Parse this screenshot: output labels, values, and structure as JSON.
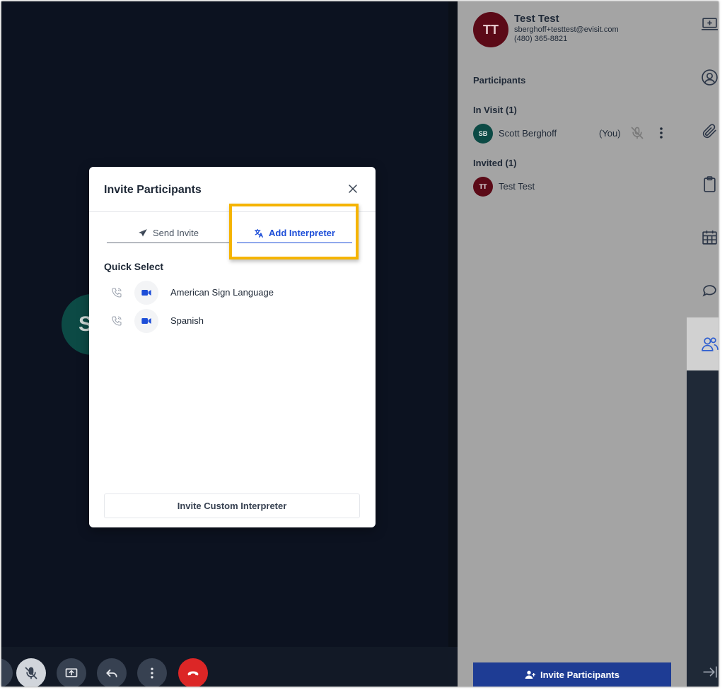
{
  "video": {
    "avatar_initials": "S"
  },
  "panel": {
    "header": {
      "initials": "TT",
      "name": "Test Test",
      "email": "sberghoff+testtest@evisit.com",
      "phone": "(480) 365-8821"
    },
    "participants_title": "Participants",
    "in_visit": {
      "label": "In Visit (1)",
      "items": [
        {
          "initials": "SB",
          "name": "Scott Berghoff",
          "tag": "(You)"
        }
      ]
    },
    "invited": {
      "label": "Invited (1)",
      "items": [
        {
          "initials": "TT",
          "name": "Test Test"
        }
      ]
    },
    "invite_button_label": "Invite Participants"
  },
  "modal": {
    "title": "Invite Participants",
    "tabs": [
      {
        "label": "Send Invite",
        "active": false
      },
      {
        "label": "Add Interpreter",
        "active": true
      }
    ],
    "quick_select": {
      "title": "Quick Select",
      "items": [
        {
          "label": "American Sign Language"
        },
        {
          "label": "Spanish"
        }
      ]
    },
    "custom_button_label": "Invite Custom Interpreter"
  },
  "colors": {
    "accent": "#1d4ed8",
    "highlight": "#f5b400",
    "invite_button": "#1e3c94",
    "end_call": "#dc2626",
    "header_avatar": "#5b0a17",
    "self_avatar": "#0c4a45"
  },
  "icons": {
    "controls": [
      "mic-muted-icon",
      "screen-share-icon",
      "reply-icon",
      "more-vertical-icon",
      "end-call-icon"
    ],
    "rail": [
      "visit-icon",
      "profile-icon",
      "attachment-icon",
      "clipboard-icon",
      "calendar-icon",
      "chat-icon",
      "participants-icon",
      "collapse-icon"
    ]
  }
}
